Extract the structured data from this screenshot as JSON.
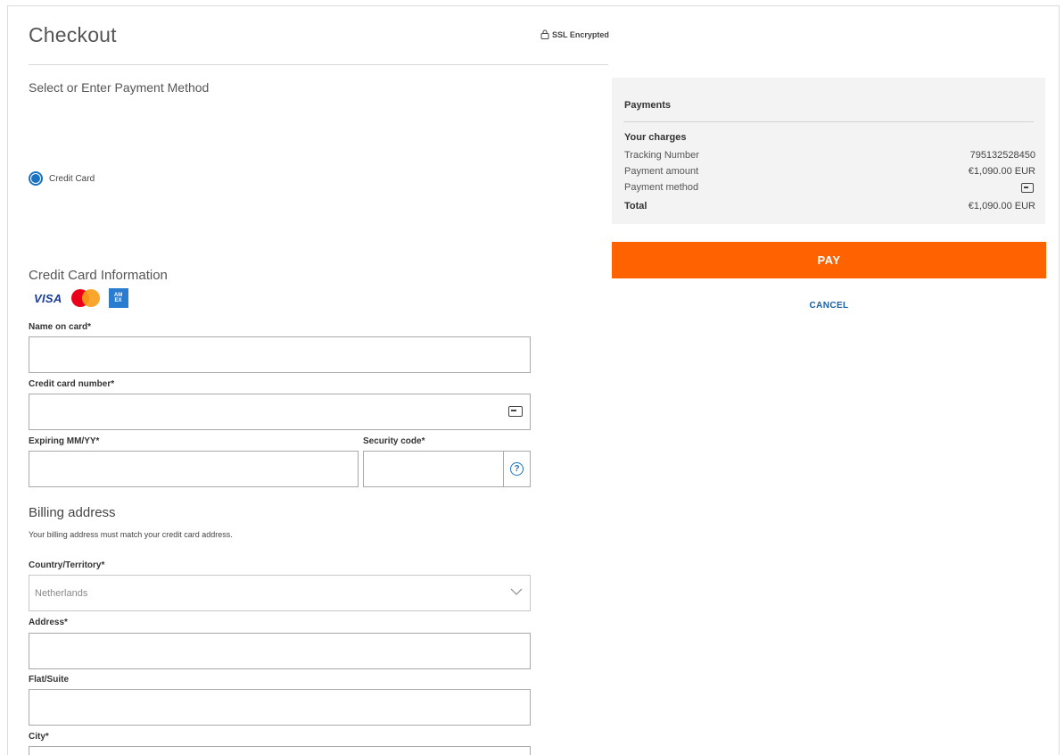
{
  "header": {
    "title": "Checkout",
    "ssl_label": "SSL Encrypted"
  },
  "payment_method": {
    "heading": "Select or Enter Payment Method",
    "option_label": "Credit Card",
    "selected": true
  },
  "credit_card": {
    "heading": "Credit Card Information",
    "logos": [
      "VISA",
      "mastercard",
      "AMERICAN EXPRESS"
    ],
    "name_label": "Name on card*",
    "name_value": "",
    "number_label": "Credit card number*",
    "number_value": "",
    "expiry_label": "Expiring MM/YY*",
    "expiry_value": "",
    "security_label": "Security code*",
    "security_value": "",
    "help_glyph": "?"
  },
  "billing": {
    "heading": "Billing address",
    "note": "Your billing address must match your credit card address.",
    "country_label": "Country/Territory*",
    "country_value": "Netherlands",
    "address_label": "Address*",
    "address_value": "",
    "flat_label": "Flat/Suite",
    "flat_value": "",
    "city_label": "City*",
    "city_value": ""
  },
  "summary": {
    "heading": "Payments",
    "charges_heading": "Your charges",
    "tracking_label": "Tracking Number",
    "tracking_value": "795132528450",
    "amount_label": "Payment amount",
    "amount_value": "€1,090.00 EUR",
    "method_label": "Payment method",
    "total_label": "Total",
    "total_value": "€1,090.00 EUR"
  },
  "actions": {
    "pay_label": "PAY",
    "cancel_label": "CANCEL"
  },
  "colors": {
    "accent": "#ff6200",
    "link": "#1a5fa8",
    "radio": "#1a73c2"
  },
  "icons": [
    "lock-icon",
    "card-icon",
    "help-icon",
    "chevron-down-icon"
  ]
}
